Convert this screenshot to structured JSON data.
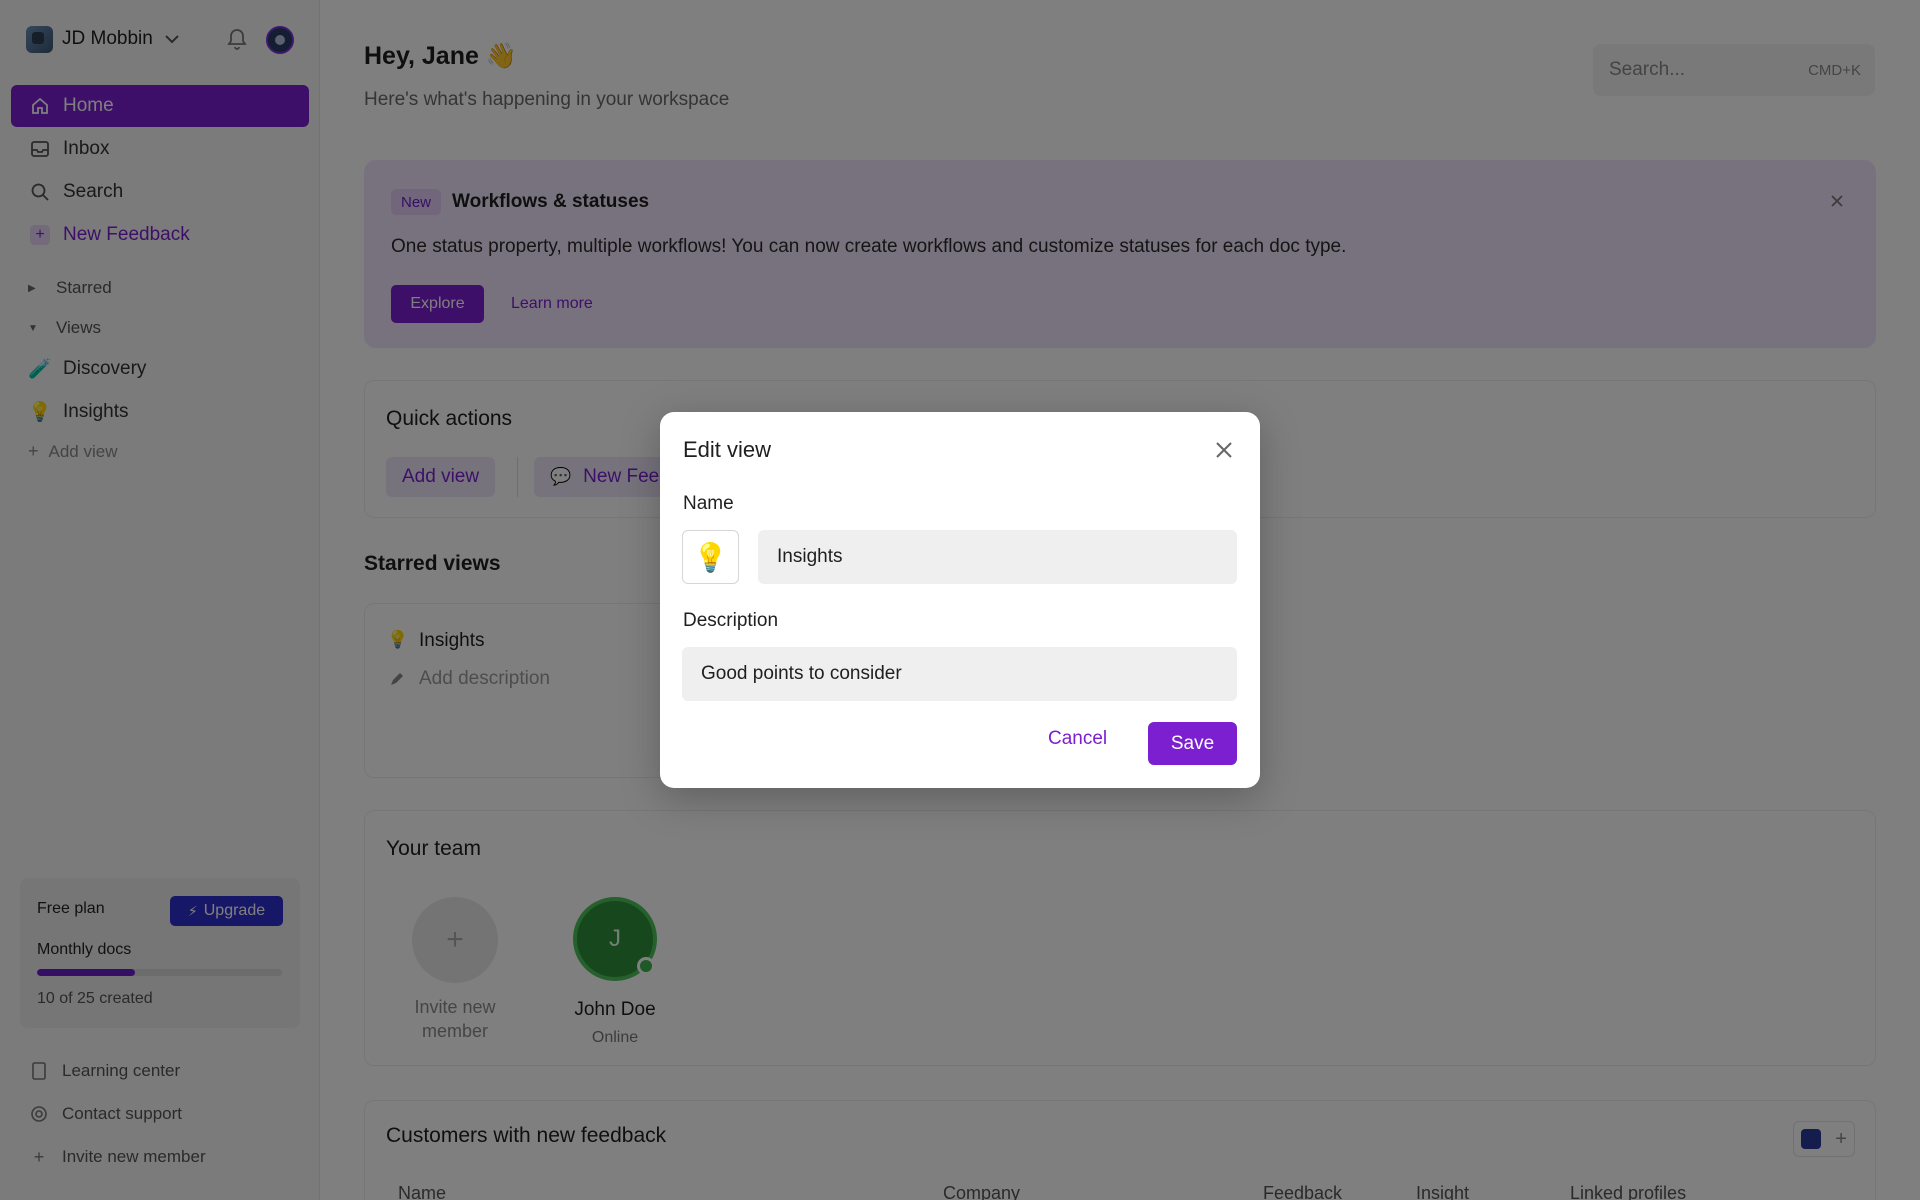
{
  "workspace": {
    "name": "JD Mobbin"
  },
  "sidebar": {
    "nav": [
      {
        "label": "Home",
        "icon": "home-icon"
      },
      {
        "label": "Inbox",
        "icon": "inbox-icon"
      },
      {
        "label": "Search",
        "icon": "search-icon"
      },
      {
        "label": "New Feedback",
        "icon": "plus-icon"
      }
    ],
    "sections": {
      "starred": "Starred",
      "views": "Views"
    },
    "views": [
      {
        "label": "Discovery",
        "emoji": "🧪"
      },
      {
        "label": "Insights",
        "emoji": "💡"
      }
    ],
    "add_view": "Add view",
    "plan": {
      "title": "Free plan",
      "upgrade": "Upgrade",
      "usage_label": "Monthly docs",
      "usage_text": "10 of 25 created",
      "usage_fraction": 0.4
    },
    "footer": [
      {
        "label": "Learning center",
        "icon": "book-icon"
      },
      {
        "label": "Contact support",
        "icon": "support-icon"
      },
      {
        "label": "Invite new member",
        "icon": "plus-icon"
      }
    ]
  },
  "header": {
    "greeting": "Hey, Jane 👋",
    "subtitle": "Here's what's happening in your workspace",
    "search_placeholder": "Search...",
    "search_shortcut": "CMD+K"
  },
  "banner": {
    "badge": "New",
    "title": "Workflows & statuses",
    "text": "One status property, multiple workflows! You can now create workflows and customize statuses for each doc type.",
    "explore": "Explore",
    "learn_more": "Learn more"
  },
  "quick_actions": {
    "title": "Quick actions",
    "add_view": "Add view",
    "new_feedback": "New Fee"
  },
  "starred_views": {
    "title": "Starred views",
    "item": {
      "name": "Insights",
      "emoji": "💡",
      "description": "Add description"
    }
  },
  "team": {
    "title": "Your team",
    "invite_line1": "Invite new",
    "invite_line2": "member",
    "member": {
      "initial": "J",
      "name": "John Doe",
      "status": "Online"
    }
  },
  "customers": {
    "title": "Customers with new feedback",
    "columns": [
      "Name",
      "Company",
      "Feedback",
      "Insight",
      "Linked profiles"
    ]
  },
  "modal": {
    "title": "Edit view",
    "name_label": "Name",
    "emoji": "💡",
    "name_value": "Insights",
    "description_label": "Description",
    "description_value": "Good points to consider",
    "cancel": "Cancel",
    "save": "Save"
  },
  "colors": {
    "accent": "#7b1fd0",
    "upgrade": "#2f2fd0",
    "online": "#3db34c"
  }
}
